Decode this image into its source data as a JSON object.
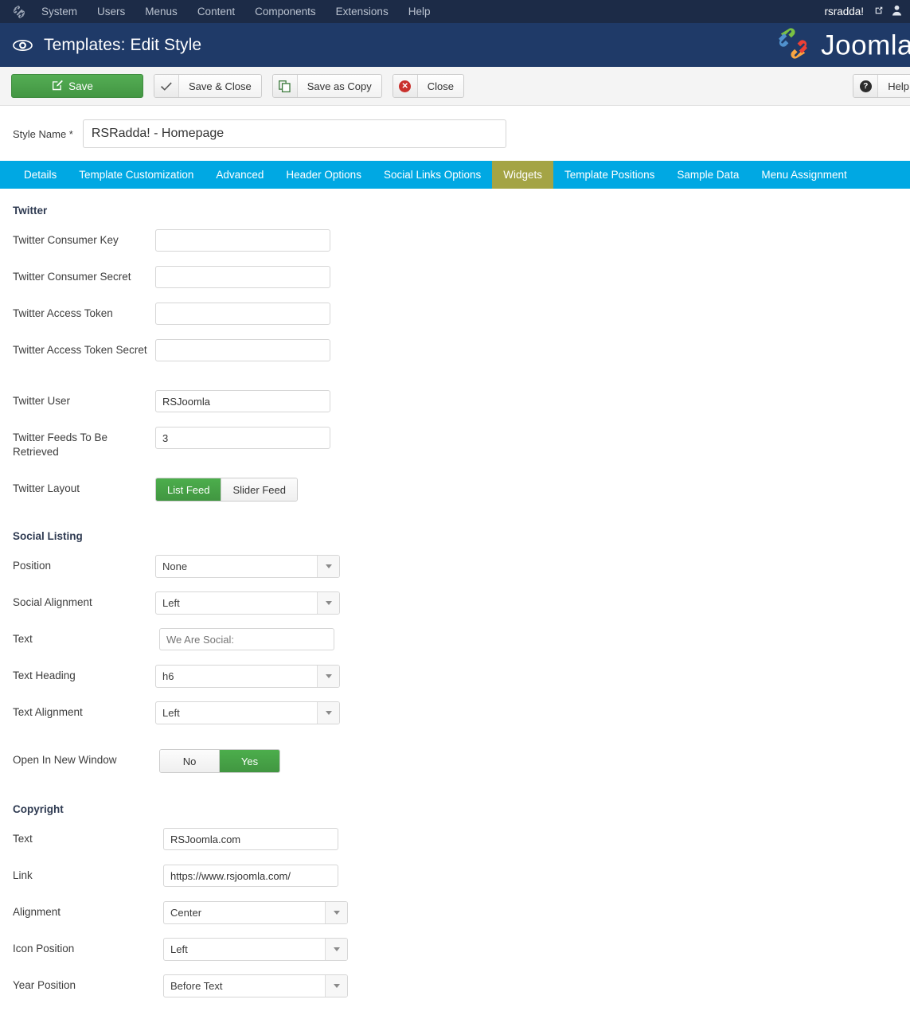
{
  "admin_bar": {
    "brand_icon": "joomla-mark-icon",
    "menu": [
      "System",
      "Users",
      "Menus",
      "Content",
      "Components",
      "Extensions",
      "Help"
    ],
    "username": "rsradda!",
    "external_link_icon": "external-link-icon",
    "user_icon": "user-icon"
  },
  "header": {
    "icon": "eye-icon",
    "title": "Templates: Edit Style",
    "brand_text": "Joomla",
    "brand_logo_icon": "joomla-logo-icon"
  },
  "toolbar": {
    "save": "Save",
    "save_icon": "save-pencil-icon",
    "save_close": "Save & Close",
    "save_close_icon": "check-icon",
    "save_as_copy": "Save as Copy",
    "save_as_copy_icon": "copy-icon",
    "close": "Close",
    "close_icon": "cancel-circle-icon",
    "help": "Help",
    "help_icon": "question-circle-icon"
  },
  "style_name": {
    "label": "Style Name *",
    "value": "RSRadda! - Homepage"
  },
  "tabs": [
    {
      "label": "Details",
      "active": false
    },
    {
      "label": "Template Customization",
      "active": false
    },
    {
      "label": "Advanced",
      "active": false
    },
    {
      "label": "Header Options",
      "active": false
    },
    {
      "label": "Social Links Options",
      "active": false
    },
    {
      "label": "Widgets",
      "active": true
    },
    {
      "label": "Template Positions",
      "active": false
    },
    {
      "label": "Sample Data",
      "active": false
    },
    {
      "label": "Menu Assignment",
      "active": false
    }
  ],
  "sections": {
    "twitter": {
      "title": "Twitter",
      "consumer_key": {
        "label": "Twitter Consumer Key",
        "value": ""
      },
      "consumer_secret": {
        "label": "Twitter Consumer Secret",
        "value": ""
      },
      "access_token": {
        "label": "Twitter Access Token",
        "value": ""
      },
      "access_token_secret": {
        "label": "Twitter Access Token Secret",
        "value": ""
      },
      "user": {
        "label": "Twitter User",
        "value": "RSJoomla"
      },
      "feeds": {
        "label": "Twitter Feeds To Be Retrieved",
        "value": "3"
      },
      "layout": {
        "label": "Twitter Layout",
        "options": [
          "List Feed",
          "Slider Feed"
        ],
        "selected": "List Feed"
      }
    },
    "social_listing": {
      "title": "Social Listing",
      "position": {
        "label": "Position",
        "value": "None"
      },
      "social_alignment": {
        "label": "Social Alignment",
        "value": "Left"
      },
      "text": {
        "label": "Text",
        "value": "",
        "placeholder": "We Are Social:"
      },
      "text_heading": {
        "label": "Text Heading",
        "value": "h6"
      },
      "text_alignment": {
        "label": "Text Alignment",
        "value": "Left"
      },
      "open_new_window": {
        "label": "Open In New Window",
        "options": [
          "No",
          "Yes"
        ],
        "selected": "Yes"
      }
    },
    "copyright": {
      "title": "Copyright",
      "text": {
        "label": "Text",
        "value": "RSJoomla.com"
      },
      "link": {
        "label": "Link",
        "value": "https://www.rsjoomla.com/"
      },
      "alignment": {
        "label": "Alignment",
        "value": "Center"
      },
      "icon_position": {
        "label": "Icon Position",
        "value": "Left"
      },
      "year_position": {
        "label": "Year Position",
        "value": "Before Text"
      }
    }
  },
  "colors": {
    "admin_bar": "#1c2b47",
    "header": "#1f3a68",
    "tabbar": "#00a8e3",
    "tab_active": "#a4a445",
    "save_green": "#47a447"
  }
}
